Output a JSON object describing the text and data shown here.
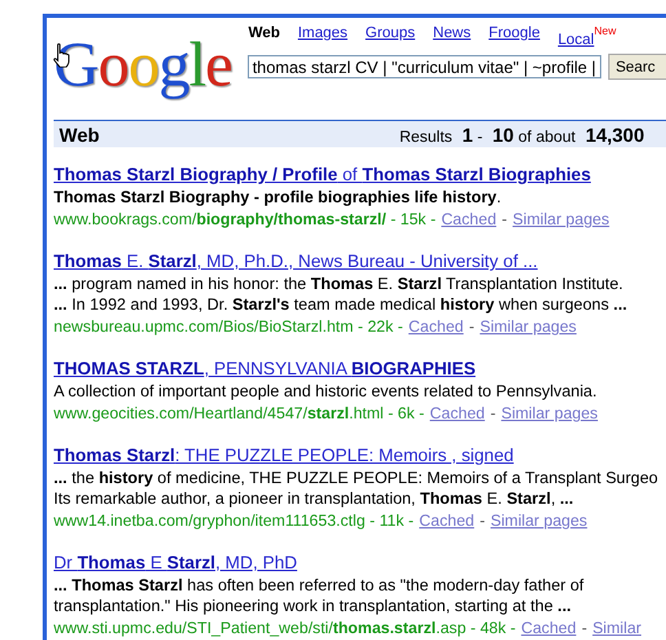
{
  "logo": [
    {
      "text": "G",
      "color": "#1f4fd0"
    },
    {
      "text": "o",
      "color": "#d2281c"
    },
    {
      "text": "o",
      "color": "#e9b10f"
    },
    {
      "text": "g",
      "color": "#1f4fd0"
    },
    {
      "text": "l",
      "color": "#2b9a2e"
    },
    {
      "text": "e",
      "color": "#d2281c"
    }
  ],
  "tabs": [
    {
      "label": "Web",
      "selected": true
    },
    {
      "label": "Images",
      "selected": false
    },
    {
      "label": "Groups",
      "selected": false
    },
    {
      "label": "News",
      "selected": false
    },
    {
      "label": "Froogle",
      "selected": false
    },
    {
      "label": "Local",
      "selected": false,
      "badge": "New"
    }
  ],
  "search": {
    "value": "thomas starzl CV | \"curriculum vitae\" | ~profile |",
    "button": "Searc"
  },
  "header": {
    "title": "Web",
    "results": "Results **1** - **10** of about **14,300**"
  },
  "separator": "-",
  "results": [
    {
      "title": "**Thomas Starzl Biography / Profile** of **Thomas Starzl Biographies**",
      "snippet": [
        "**Thomas Starzl Biography - profile biographies life history**."
      ],
      "url": "www.bookrags.com/**biography/thomas-starzl/** - 15k -",
      "links": [
        "Cached",
        "Similar pages"
      ]
    },
    {
      "title": "**Thomas** E. **Starzl**, MD, Ph.D., News Bureau - University of ...",
      "snippet": [
        "**...** program named in his honor: the **Thomas** E. **Starzl** Transplantation Institute.",
        "**...** In 1992 and 1993, Dr. **Starzl's** team made medical **history** when surgeons **...**"
      ],
      "url": "newsbureau.upmc.com/Bios/BioStarzl.htm - 22k -",
      "links": [
        "Cached",
        "Similar pages"
      ]
    },
    {
      "title": "**THOMAS STARZL**, PENNSYLVANIA **BIOGRAPHIES**",
      "snippet": [
        "A collection of important people and historic events related to Pennsylvania."
      ],
      "url": "www.geocities.com/Heartland/4547/**starzl**.html - 6k -",
      "links": [
        "Cached",
        "Similar pages"
      ]
    },
    {
      "title": "**Thomas Starzl**: THE PUZZLE PEOPLE: Memoirs , signed",
      "snippet": [
        "**...** the **history** of medicine, THE PUZZLE PEOPLE: Memoirs of a Transplant Surgeo",
        "Its remarkable author, a pioneer in transplantation, **Thomas** E. **Starzl**, **...**"
      ],
      "url": "www14.inetba.com/gryphon/item111653.ctlg - 11k -",
      "links": [
        "Cached",
        "Similar pages"
      ]
    },
    {
      "title": "Dr **Thomas** E **Starzl**, MD, PhD",
      "snippet": [
        "**... Thomas Starzl** has often been referred to as \"the modern-day father of",
        "transplantation.\" His pioneering work in transplantation, starting at the **...**"
      ],
      "url": "www.sti.upmc.edu/STI_Patient_web/sti/**thomas.starzl**.asp - 48k -",
      "links": [
        "Cached",
        "Similar"
      ]
    }
  ]
}
